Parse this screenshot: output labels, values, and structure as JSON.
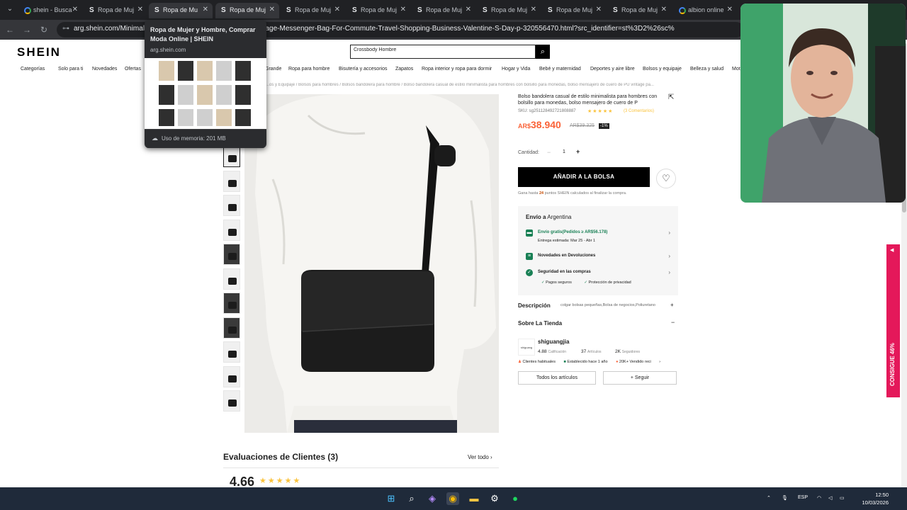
{
  "browser": {
    "tabs": [
      {
        "title": "shein - Busca",
        "favicon": "google"
      },
      {
        "title": "Ropa de Muj",
        "favicon": "shein"
      },
      {
        "title": "Ropa de Mu",
        "favicon": "shein"
      },
      {
        "title": "Ropa de Muj",
        "favicon": "shein"
      },
      {
        "title": "Ropa de Muj",
        "favicon": "shein"
      },
      {
        "title": "Ropa de Muj",
        "favicon": "shein"
      },
      {
        "title": "Ropa de Muj",
        "favicon": "shein"
      },
      {
        "title": "Ropa de Muj",
        "favicon": "shein"
      },
      {
        "title": "Ropa de Muj",
        "favicon": "shein"
      },
      {
        "title": "Ropa de Muj",
        "favicon": "shein"
      },
      {
        "title": "albion online",
        "favicon": "google"
      }
    ],
    "url": "arg.shein.com/Minimalis...al-Crossbody-Bag-PU-Leather-Vintage-Messenger-Bag-For-Commute-Travel-Shopping-Business-Valentine-S-Day-p-32055647​0.html?src_identifier=st%3D2%26sc%",
    "hovercard": {
      "title": "Ropa de Mujer y Hombre, Comprar Moda Online | SHEIN",
      "domain": "arg.shein.com",
      "memory": "Uso de memoria: 201 MB"
    }
  },
  "header": {
    "logo": "SHEIN",
    "search_value": "Crossbody Hombre",
    "nav": [
      "Categorías",
      "Solo para ti",
      "Novedades",
      "Ofertas",
      "Grande",
      "Ropa para hombre",
      "Bisutería y accesorios",
      "Zapatos",
      "Ropa interior y ropa para dormir",
      "Hogar y Vida",
      "Bebé y maternidad",
      "Deportes y aire libre",
      "Bolsos y equipaje",
      "Belleza y salud",
      "Mot"
    ]
  },
  "breadcrumb": "...os y Equipaje / Bolsos para hombres / Bolsos bandolera para hombre / Bolso bandolera casual de estilo minimalista para hombres con bolsillo para monedas, bolso mensajero de cuero de PU vintage pa...",
  "product": {
    "title": "Bolso bandolera casual de estilo minimalista para hombres con bolsillo para monedas, bolso mensajero de cuero de P",
    "sku": "SKU: sg2511284927​21808887",
    "rating_stars": "★★★★★",
    "reviews_link": "(3 Comentarios)",
    "price_currency": "AR$",
    "price": "38.940",
    "old_price": "AR$39.325",
    "discount": "-1%",
    "qty_label": "Cantidad:",
    "qty_minus": "−",
    "qty": "1",
    "qty_plus": "+",
    "add_to_bag": "AÑADIR A LA BOLSA",
    "points_prefix": "Gana hasta",
    "points_value": "24",
    "points_suffix": "puntos SHEIN calculados al finalizar la compra."
  },
  "shipping": {
    "title_prefix": "Envío a",
    "country": "Argentina",
    "free_shipping": "Envío gratis(Pedidos ≥ AR$56.178)",
    "delivery": "Entrega estimada: Mar 25 - Abr 1",
    "returns": "Novedades en Devoluciones",
    "security": "Seguridad en las compras",
    "check1": "Pagos seguros",
    "check2": "Protección de privacidad"
  },
  "description": {
    "title": "Descripción",
    "text": "colgar bolsas pequeñas,Bolsa de negocios,Poliuretano"
  },
  "store": {
    "title": "Sobre La Tienda",
    "logo_text": "shiguang",
    "name": "shiguangjia",
    "rating": "4.88",
    "rating_label": "Calificación",
    "items": "37",
    "items_label": "Artículos",
    "followers": "2K",
    "followers_label": "Seguidores",
    "tag1": "Clientes habituales",
    "tag2": "Establecido hace 1 año",
    "tag3": "20K+ Vendido reci",
    "all_items": "Todos los artículos",
    "follow": "+ Seguir"
  },
  "reviews": {
    "title": "Evaluaciones de Clientes (3)",
    "see_all": "Ver todo",
    "score": "4.66",
    "stars": "★★★★★"
  },
  "promo": {
    "text": "CONSIGUE 46%"
  },
  "taskbar": {
    "lang": "ESP",
    "time": "12:50",
    "date": "10/03/2026"
  },
  "colors": {
    "price": "#fa6338",
    "star": "#fac33d",
    "green": "#198055",
    "promo": "#e4185a"
  }
}
